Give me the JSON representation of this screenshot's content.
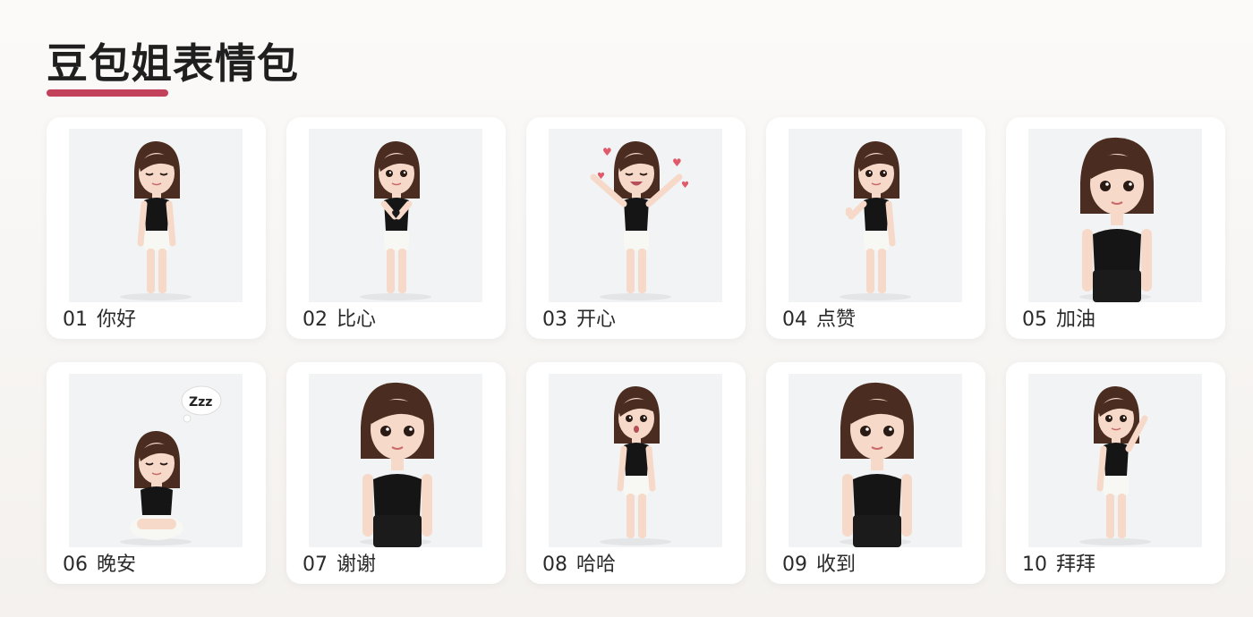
{
  "page": {
    "title": "豆包姐表情包",
    "accent_color": "#c4415c"
  },
  "stickers": [
    {
      "number": "01",
      "label": "你好",
      "pose": "eyes-closed-smile"
    },
    {
      "number": "02",
      "label": "比心",
      "pose": "heart-hands"
    },
    {
      "number": "03",
      "label": "开心",
      "pose": "jumping-peace-signs-hearts"
    },
    {
      "number": "04",
      "label": "点赞",
      "pose": "thumbs-up"
    },
    {
      "number": "05",
      "label": "加油",
      "pose": "standing-closeup"
    },
    {
      "number": "06",
      "label": "晚安",
      "pose": "sleeping-zzz"
    },
    {
      "number": "07",
      "label": "谢谢",
      "pose": "standing-closeup"
    },
    {
      "number": "08",
      "label": "哈哈",
      "pose": "surprised"
    },
    {
      "number": "09",
      "label": "收到",
      "pose": "standing-closeup"
    },
    {
      "number": "10",
      "label": "拜拜",
      "pose": "waving"
    }
  ]
}
